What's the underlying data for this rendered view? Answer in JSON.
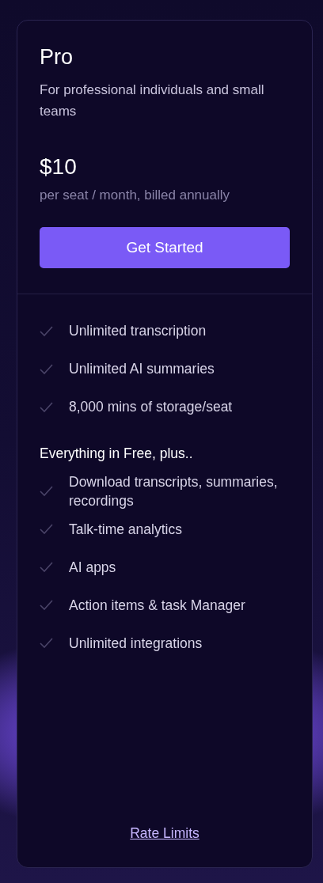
{
  "plan": {
    "name": "Pro",
    "description": "For professional individuals and small teams",
    "price": "$10",
    "price_note": "per seat / month, billed annually",
    "cta": "Get Started"
  },
  "features": [
    "Unlimited transcription",
    "Unlimited AI summaries",
    "8,000 mins of storage/seat"
  ],
  "extras_heading": "Everything in Free, plus..",
  "extras": [
    "Download transcripts, summaries, recordings",
    "Talk-time analytics",
    "AI apps",
    "Action items & task Manager",
    "Unlimited integrations"
  ],
  "footer_link": "Rate Limits"
}
